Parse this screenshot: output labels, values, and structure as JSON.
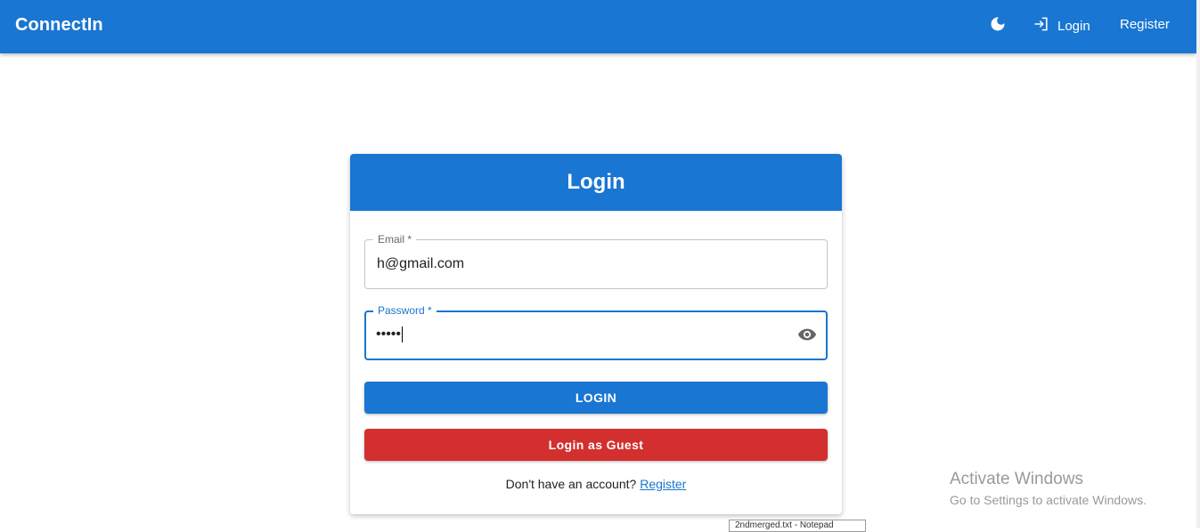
{
  "appbar": {
    "brand": "ConnectIn",
    "theme_icon": "moon-icon",
    "login_icon": "login-icon",
    "login_label": "Login",
    "register_label": "Register",
    "color": "#1976d2"
  },
  "card": {
    "title": "Login",
    "email": {
      "label": "Email *",
      "value": "h@gmail.com"
    },
    "password": {
      "label": "Password *",
      "value": "•••••",
      "toggle_icon": "eye-icon"
    },
    "login_button": "LOGIN",
    "guest_button": "Login as Guest",
    "footer_text": "Don't have an account?",
    "footer_link": "Register",
    "colors": {
      "primary": "#1976d2",
      "guest": "#d32f2f"
    }
  },
  "watermark": {
    "title": "Activate Windows",
    "subtitle": "Go to Settings to activate Windows."
  },
  "taskbar_tip": "2ndmerged.txt - Notepad"
}
